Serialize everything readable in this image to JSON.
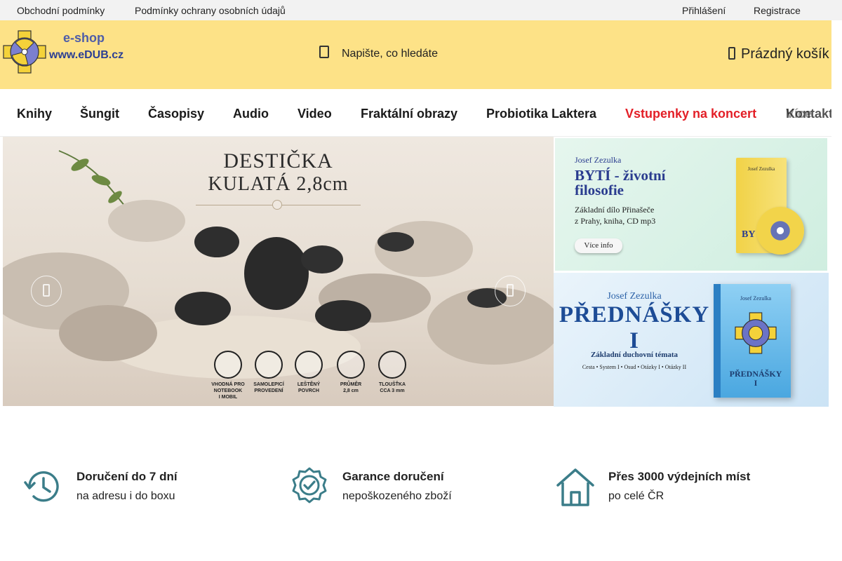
{
  "topbar": {
    "links": [
      {
        "label": "Obchodní podmínky"
      },
      {
        "label": "Podmínky ochrany osobních údajů"
      }
    ],
    "account": {
      "login": "Přihlášení",
      "register": "Registrace"
    }
  },
  "header": {
    "logo": {
      "eshop": "e-shop",
      "url": "www.eDUB.cz"
    },
    "search": {
      "placeholder": "Napište, co hledáte"
    },
    "cart": {
      "label": "Prázdný košík"
    }
  },
  "nav": {
    "items": [
      {
        "label": "Knihy"
      },
      {
        "label": "Šungit"
      },
      {
        "label": "Časopisy"
      },
      {
        "label": "Audio"
      },
      {
        "label": "Video"
      },
      {
        "label": "Fraktální obrazy"
      },
      {
        "label": "Probiotika Laktera"
      },
      {
        "label": "Vstupenky na koncert"
      }
    ],
    "overflow_label_more": "Více",
    "overflow_label_contact": "Kontakt"
  },
  "hero": {
    "title_line1": "DESTIČKA",
    "title_line2": "KULATÁ 2,8cm",
    "features": [
      {
        "label_l1": "VHODNÁ PRO",
        "label_l2": "NOTEBOOK",
        "label_l3": "I MOBIL"
      },
      {
        "label_l1": "SAMOLEPICÍ",
        "label_l2": "PROVEDENÍ",
        "label_l3": ""
      },
      {
        "label_l1": "LEŠTĚNÝ",
        "label_l2": "POVRCH",
        "label_l3": ""
      },
      {
        "label_l1": "PRŮMĚR",
        "label_l2": "2,8 cm",
        "label_l3": ""
      },
      {
        "label_l1": "TLOUŠŤKA",
        "label_l2": "CCA 3 mm",
        "label_l3": ""
      }
    ]
  },
  "banner_book1": {
    "author": "Josef Zezulka",
    "title": "BYTÍ - životní filosofie",
    "subtitle_l1": "Základní dílo Přinašeče",
    "subtitle_l2": "z Prahy, kniha, CD mp3",
    "button": "Více info",
    "cover_author": "Josef Zezulka",
    "cover_title": "BY"
  },
  "banner_book2": {
    "author": "Josef Zezulka",
    "title": "PŘEDNÁŠKY I",
    "subtitle": "Základní duchovní témata",
    "topics": "Cesta  •  System I  •  Osud  •  Otázky I  •  Otázky II",
    "cover_author": "Josef Zezulka",
    "cover_title_l1": "PŘEDNÁŠKY",
    "cover_title_l2": "I"
  },
  "benefits": [
    {
      "title": "Doručení do 7 dní",
      "subtitle": "na adresu i do boxu",
      "icon": "clock-history-icon"
    },
    {
      "title": "Garance doručení",
      "subtitle": "nepoškozeného zboží",
      "icon": "verified-badge-icon"
    },
    {
      "title": "Přes 3000 výdejních míst",
      "subtitle": "po celé ČR",
      "icon": "home-icon"
    }
  ],
  "colors": {
    "header_bg": "#fde287",
    "accent_red": "#e31f27",
    "icon_teal": "#3b7d89",
    "logo_blue": "#2b3f94"
  }
}
